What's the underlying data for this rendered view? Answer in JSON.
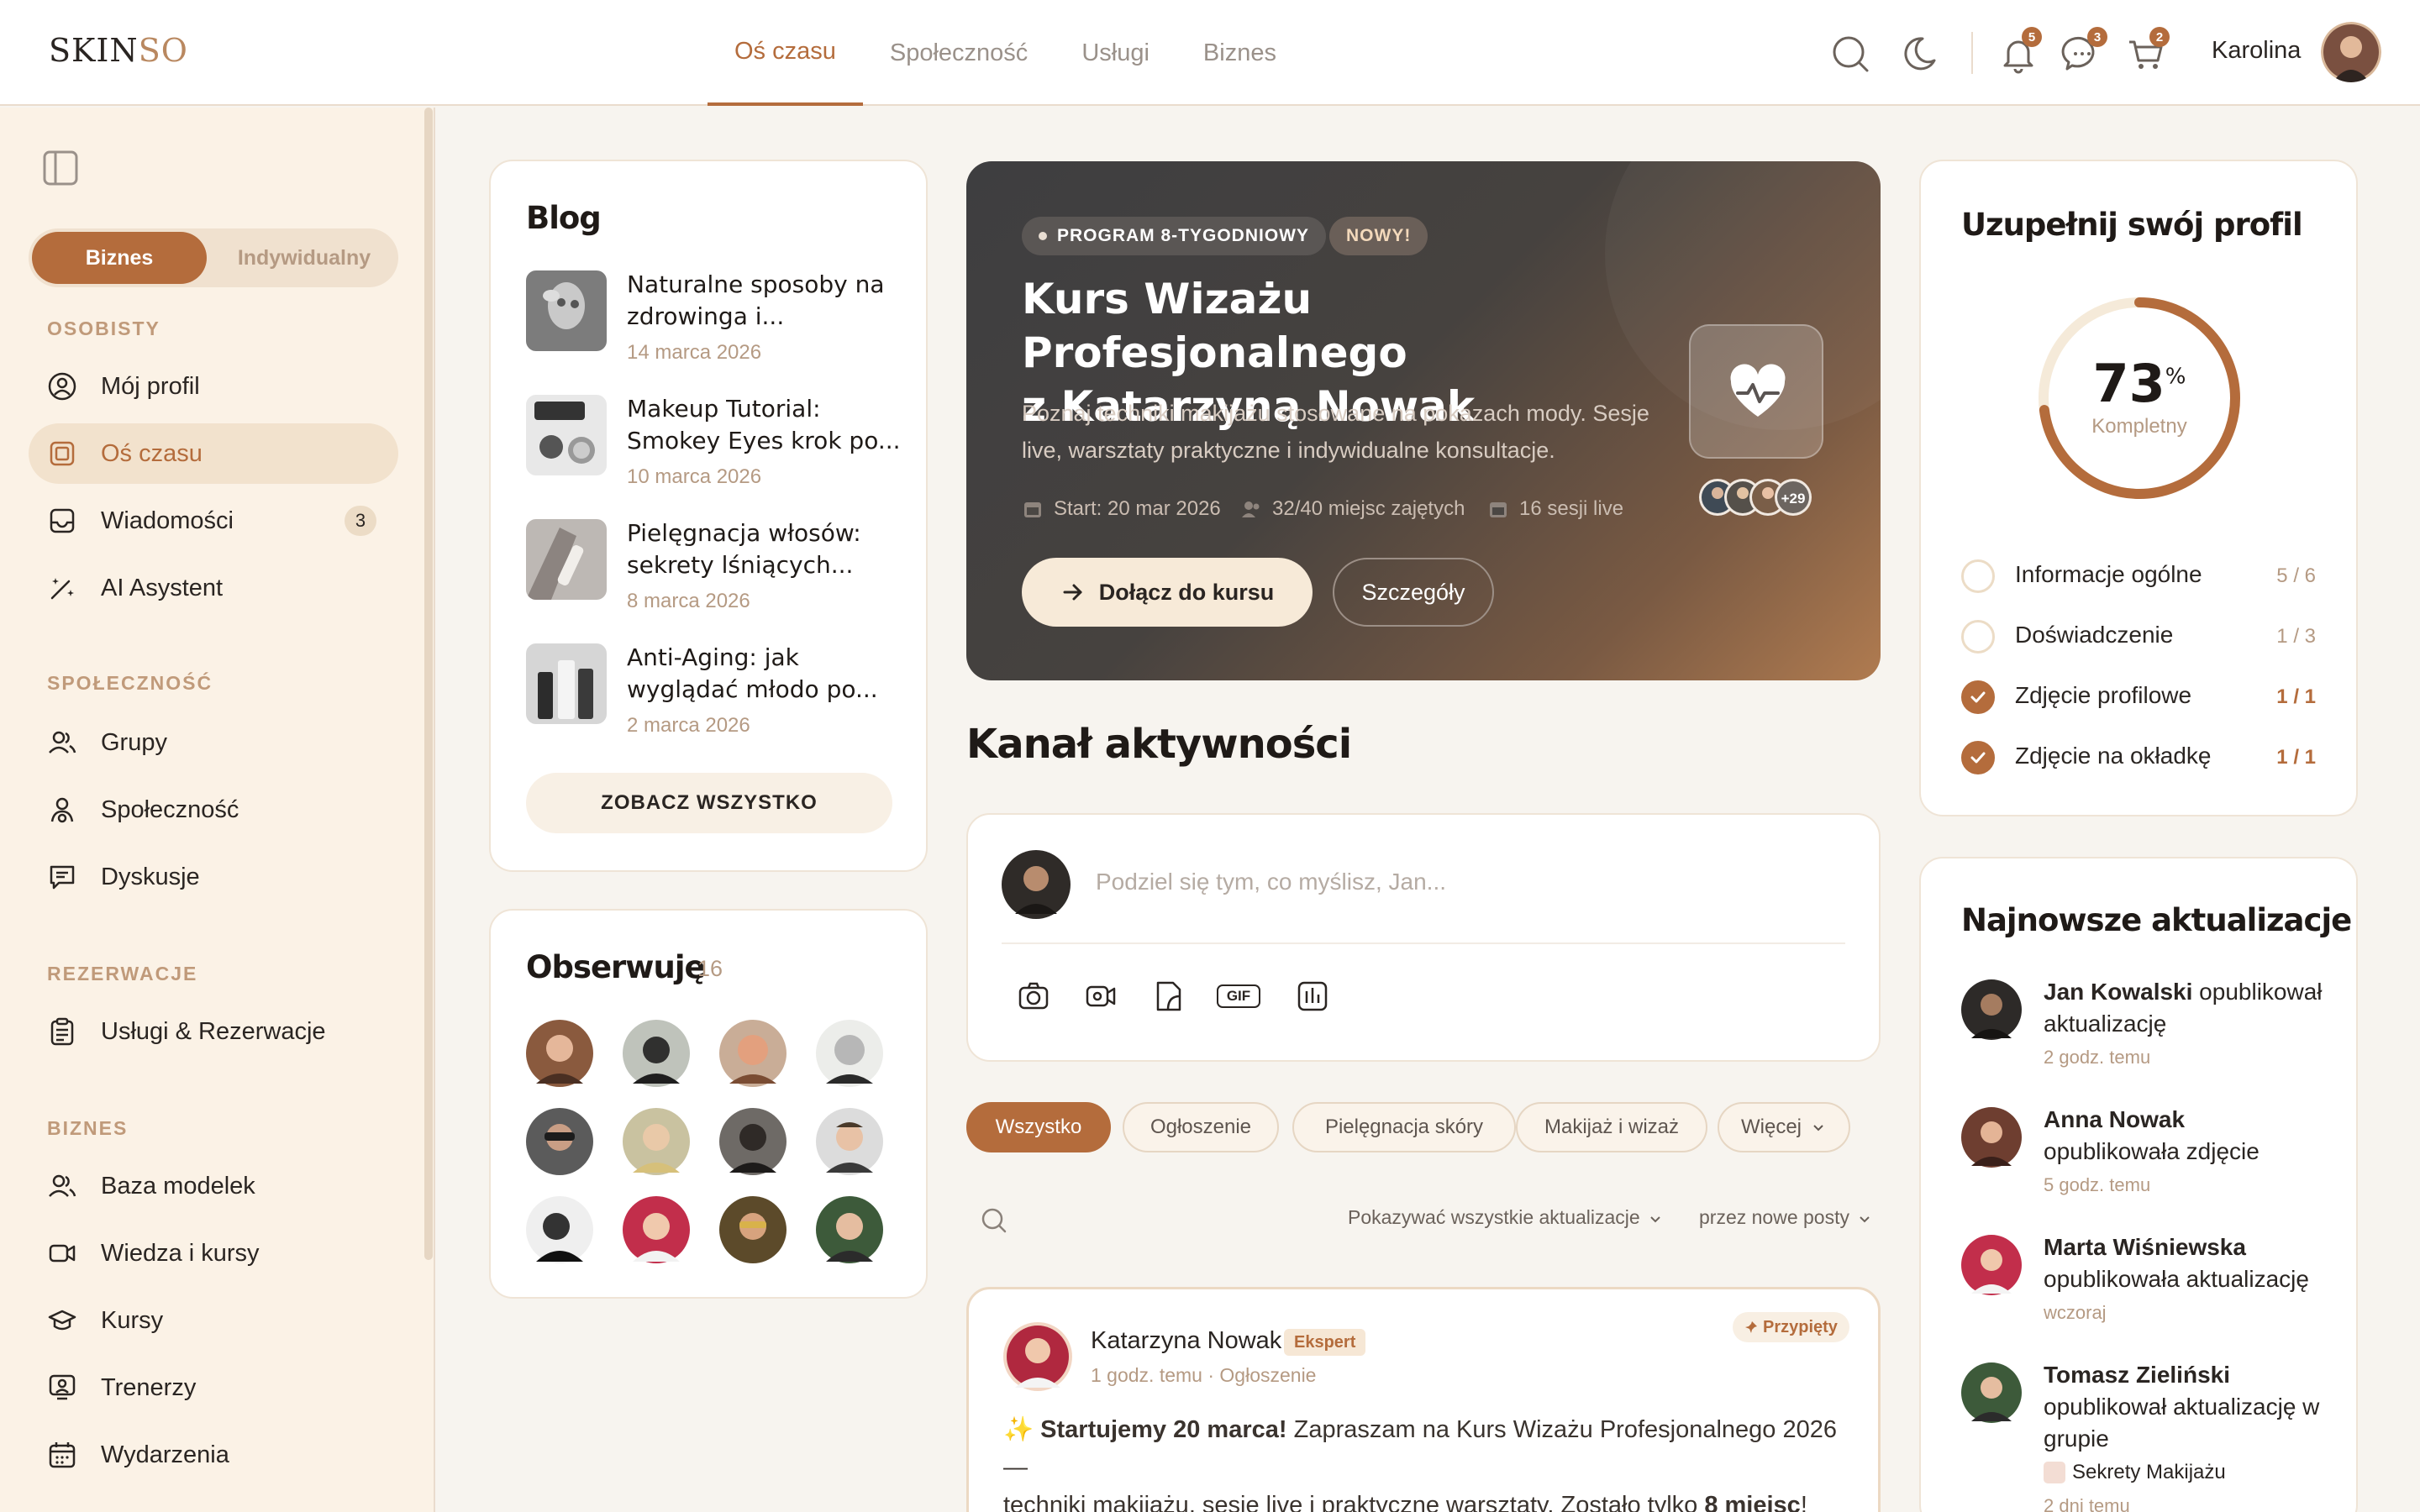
{
  "logo": {
    "a": "SKIN",
    "b": "SO"
  },
  "nav": [
    {
      "label": "Oś czasu",
      "active": true
    },
    {
      "label": "Społeczność"
    },
    {
      "label": "Usługi"
    },
    {
      "label": "Biznes"
    }
  ],
  "header": {
    "bell_count": "5",
    "chat_count": "3",
    "cart_count": "2",
    "user_name": "Karolina"
  },
  "sidebar": {
    "toggle_on": "Biznes",
    "toggle_off": "Indywidualny",
    "sec_personal": "OSOBISTY",
    "my_profile": "Mój profil",
    "timeline": "Oś czasu",
    "messages": "Wiadomości",
    "messages_count": "3",
    "ai": "AI Asystent",
    "sec_community": "SPOŁECZNOŚĆ",
    "groups": "Grupy",
    "community": "Społeczność",
    "discussions": "Dyskusje",
    "sec_bookings": "REZERWACJE",
    "services": "Usługi & Rezerwacje",
    "sec_business": "BIZNES",
    "models": "Baza modelek",
    "knowledge": "Wiedza i kursy",
    "courses": "Kursy",
    "trainers": "Trenerzy",
    "events": "Wydarzenia"
  },
  "blog": {
    "title": "Blog",
    "posts": [
      {
        "title": "Naturalne sposoby na zdrowinga i...",
        "date": "14 marca 2026"
      },
      {
        "title": "Makeup Tutorial: Smokey Eyes krok po...",
        "date": "10 marca 2026"
      },
      {
        "title": "Pielęgnacja włosów: sekrety lśniących...",
        "date": "8 marca 2026"
      },
      {
        "title": "Anti-Aging: jak wyglądać młodo po...",
        "date": "2 marca 2026"
      }
    ],
    "see_all": "ZOBACZ WSZYSTKO"
  },
  "following": {
    "title": "Obserwuję",
    "count": "16"
  },
  "hero": {
    "pill1": "PROGRAM 8-TYGODNIOWY",
    "pill2": "NOWY!",
    "title_line1": "Kurs Wizażu Profesjonalnego",
    "title_line2": "z Katarzyną Nowak",
    "desc": "Poznaj techniki makijażu stosowane na pokazach mody. Sesje live, warsztaty praktyczne i indywidualne konsultacje.",
    "start": "Start: 20 mar 2026",
    "seats": "32/40 miejsc zajętych",
    "sessions": "16 sesji live",
    "more_avatars": "+29",
    "join": "Dołącz do kursu",
    "details": "Szczegóły"
  },
  "feed": {
    "title": "Kanał aktywności",
    "composer_placeholder": "Podziel się tym, co myślisz, Jan...",
    "gif": "GIF",
    "filters": [
      "Wszystko",
      "Ogłoszenie",
      "Pielęgnacja skóry",
      "Makijaż i wizaż",
      "Więcej"
    ],
    "sort_show": "Pokazywać wszystkie aktualizacje",
    "sort_order": "przez nowe posty",
    "post": {
      "author": "Katarzyna Nowak",
      "badge": "Ekspert",
      "meta": "1 godz. temu · Ogłoszenie",
      "pinned": "Przypięty",
      "spark": "✨",
      "lead": "Startujemy 20 marca!",
      "text1": " Zapraszam na Kurs Wizażu Profesjonalnego 2026 —",
      "text2": "techniki makijażu, sesje live i praktyczne warsztaty. Zostało tylko ",
      "bold2": "8 miejsc",
      "end": "!"
    }
  },
  "profile": {
    "title": "Uzupełnij swój profil",
    "percent": "73",
    "percent_sign": "%",
    "percent_value": 73,
    "subtitle": "Kompletny",
    "items": [
      {
        "label": "Informacje ogólne",
        "value": "5 / 6",
        "done": false
      },
      {
        "label": "Doświadczenie",
        "value": "1 / 3",
        "done": false
      },
      {
        "label": "Zdjęcie profilowe",
        "value": "1 / 1",
        "done": true
      },
      {
        "label": "Zdjęcie na okładkę",
        "value": "1 / 1",
        "done": true
      }
    ]
  },
  "updates": {
    "title": "Najnowsze aktualizacje",
    "items": [
      {
        "name": "Jan Kowalski",
        "action": " opublikował aktualizację",
        "time": "2 godz. temu"
      },
      {
        "name": "Anna Nowak",
        "action": "opublikowała zdjęcie",
        "time": "5 godz. temu"
      },
      {
        "name": "Marta Wiśniewska",
        "action": "opublikowała aktualizację",
        "time": "wczoraj"
      },
      {
        "name": "Tomasz Zieliński",
        "action": "opublikował aktualizację w grupie",
        "group": "Sekrety Makijażu",
        "time": "2 dni temu"
      }
    ]
  }
}
